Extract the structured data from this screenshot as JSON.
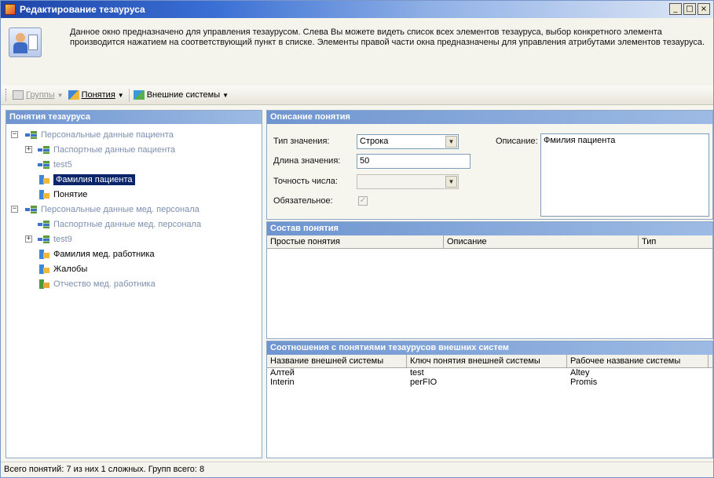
{
  "window": {
    "title": "Редактирование тезауруса",
    "buttons": [
      "_",
      "□",
      "×"
    ]
  },
  "info": {
    "text": "Данное окно предназначено для управления тезаурусом. Слева Вы можете видеть список всех элементов тезауруса, выбор конкретного элемента производится нажатием на соответствующий пункт в списке. Элементы правой части окна предназначены для управления атрибутами элементов тезауруса."
  },
  "toolbar": {
    "groups_label": "Группы",
    "concepts_label": "Понятия",
    "external_label": "Внешние системы"
  },
  "tree": {
    "header": "Понятия тезауруса",
    "items": [
      {
        "label": "Персональные данные пациента",
        "icon": "group-icon"
      },
      {
        "label": "Паспортные данные пациента",
        "icon": "group-icon"
      },
      {
        "label": "test5",
        "icon": "group-icon"
      },
      {
        "label": "Фамилия пациента",
        "icon": "concept-icon"
      },
      {
        "label": "Понятие",
        "icon": "concept-icon"
      },
      {
        "label": "Персональные данные мед. персонала",
        "icon": "group-icon"
      },
      {
        "label": "Паспортные данные мед. персонала",
        "icon": "group-icon"
      },
      {
        "label": "test9",
        "icon": "group-icon"
      },
      {
        "label": "Фамилия мед. работника",
        "icon": "concept-icon"
      },
      {
        "label": "Жалобы",
        "icon": "concept-icon"
      },
      {
        "label": "Отчество мед. работника",
        "icon": "concept-complex-icon"
      }
    ]
  },
  "description": {
    "header": "Описание понятия",
    "value_type_label": "Тип значения:",
    "value_type_value": "Строка",
    "length_label": "Длина значения:",
    "length_value": "50",
    "precision_label": "Точность числа:",
    "precision_value": "",
    "required_label": "Обязательное:",
    "required_checked": true,
    "desc_label": "Описание:",
    "desc_value": "Фмилия пациента"
  },
  "composition": {
    "header": "Состав понятия",
    "columns": [
      "Простые понятия",
      "Описание",
      "Тип"
    ],
    "rows": []
  },
  "relations": {
    "header": "Соотношения с понятиями тезаурусов внешних систем",
    "columns": [
      "Название внешней системы",
      "Ключ понятия внешней системы",
      "Рабочее название системы"
    ],
    "rows": [
      [
        "Алтей",
        "test",
        "Altey"
      ],
      [
        "Interin",
        "perFIO",
        "Promis"
      ]
    ]
  },
  "status": {
    "text": "Всего понятий: 7 из них 1 сложных. Групп всего: 8"
  }
}
